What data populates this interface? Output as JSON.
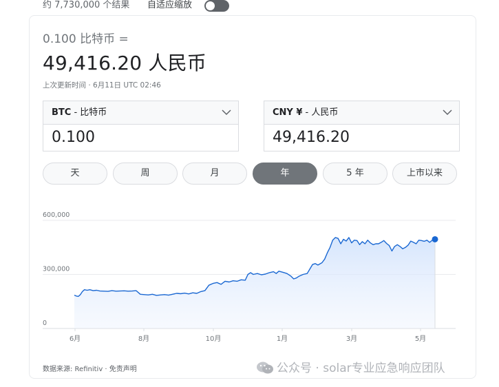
{
  "header": {
    "results_text": "约 7,730,000 个结果",
    "adaptive_label": "自适应缩放",
    "adaptive_on": false
  },
  "converter": {
    "from_line": "0.100 比特币 =",
    "result_line": "49,416.20 人民币",
    "updated_text": "上次更新时间 · 6月11日 UTC 02:46",
    "from": {
      "code": "BTC",
      "name": " - 比特币",
      "value": "0.100"
    },
    "to": {
      "code": "CNY ¥",
      "name": " - 人民币",
      "value": "49,416.20"
    }
  },
  "ranges": {
    "items": [
      "天",
      "周",
      "月",
      "年",
      "5 年",
      "上市以来"
    ],
    "active": "年"
  },
  "colors": {
    "accent": "#1a73e8",
    "line": "#1967d2",
    "active_pill": "#70757a"
  },
  "footer": {
    "source_text": "数据来源: Refinitiv · 免责声明",
    "watermark_text": "公众号 · solar专业应急响应团队"
  },
  "chart_data": {
    "type": "area",
    "yticks": [
      "600,000",
      "300,000",
      "0"
    ],
    "ylim": [
      0,
      600000
    ],
    "xticks": [
      "6月",
      "8月",
      "10月",
      "1月",
      "3月",
      "5月"
    ],
    "grid": true,
    "points": [
      [
        0,
        185000
      ],
      [
        3,
        180000
      ],
      [
        6,
        178000
      ],
      [
        9,
        188000
      ],
      [
        12,
        205000
      ],
      [
        15,
        215000
      ],
      [
        19,
        212000
      ],
      [
        23,
        215000
      ],
      [
        28,
        210000
      ],
      [
        33,
        212000
      ],
      [
        38,
        208000
      ],
      [
        44,
        207000
      ],
      [
        50,
        206000
      ],
      [
        56,
        210000
      ],
      [
        62,
        207000
      ],
      [
        68,
        208000
      ],
      [
        74,
        209000
      ],
      [
        80,
        207000
      ],
      [
        86,
        208000
      ],
      [
        92,
        210000
      ],
      [
        98,
        190000
      ],
      [
        104,
        188000
      ],
      [
        110,
        186000
      ],
      [
        116,
        190000
      ],
      [
        122,
        184000
      ],
      [
        128,
        186000
      ],
      [
        134,
        188000
      ],
      [
        140,
        185000
      ],
      [
        146,
        190000
      ],
      [
        152,
        195000
      ],
      [
        158,
        193000
      ],
      [
        164,
        196000
      ],
      [
        170,
        192000
      ],
      [
        176,
        198000
      ],
      [
        182,
        195000
      ],
      [
        188,
        205000
      ],
      [
        194,
        210000
      ],
      [
        200,
        240000
      ],
      [
        206,
        250000
      ],
      [
        212,
        255000
      ],
      [
        218,
        245000
      ],
      [
        224,
        262000
      ],
      [
        230,
        258000
      ],
      [
        236,
        265000
      ],
      [
        242,
        262000
      ],
      [
        248,
        270000
      ],
      [
        254,
        268000
      ],
      [
        258,
        300000
      ],
      [
        262,
        310000
      ],
      [
        266,
        300000
      ],
      [
        272,
        305000
      ],
      [
        278,
        298000
      ],
      [
        284,
        302000
      ],
      [
        290,
        310000
      ],
      [
        296,
        315000
      ],
      [
        300,
        305000
      ],
      [
        304,
        318000
      ],
      [
        310,
        312000
      ],
      [
        316,
        305000
      ],
      [
        322,
        290000
      ],
      [
        326,
        275000
      ],
      [
        330,
        280000
      ],
      [
        334,
        290000
      ],
      [
        340,
        300000
      ],
      [
        346,
        305000
      ],
      [
        350,
        330000
      ],
      [
        354,
        355000
      ],
      [
        358,
        360000
      ],
      [
        362,
        352000
      ],
      [
        368,
        365000
      ],
      [
        372,
        385000
      ],
      [
        376,
        420000
      ],
      [
        380,
        450000
      ],
      [
        384,
        490000
      ],
      [
        388,
        505000
      ],
      [
        392,
        500000
      ],
      [
        396,
        470000
      ],
      [
        400,
        495000
      ],
      [
        404,
        485000
      ],
      [
        408,
        505000
      ],
      [
        412,
        475000
      ],
      [
        416,
        490000
      ],
      [
        420,
        488000
      ],
      [
        424,
        465000
      ],
      [
        428,
        482000
      ],
      [
        432,
        470000
      ],
      [
        436,
        490000
      ],
      [
        440,
        475000
      ],
      [
        444,
        465000
      ],
      [
        448,
        470000
      ],
      [
        452,
        470000
      ],
      [
        456,
        478000
      ],
      [
        460,
        488000
      ],
      [
        464,
        472000
      ],
      [
        468,
        460000
      ],
      [
        472,
        430000
      ],
      [
        476,
        455000
      ],
      [
        480,
        465000
      ],
      [
        484,
        455000
      ],
      [
        488,
        442000
      ],
      [
        492,
        450000
      ],
      [
        496,
        462000
      ],
      [
        500,
        485000
      ],
      [
        504,
        478000
      ],
      [
        508,
        470000
      ],
      [
        512,
        490000
      ],
      [
        516,
        488000
      ],
      [
        520,
        484000
      ],
      [
        524,
        490000
      ],
      [
        528,
        478000
      ],
      [
        532,
        490000
      ],
      [
        536,
        495000
      ]
    ],
    "x_total": 536
  }
}
